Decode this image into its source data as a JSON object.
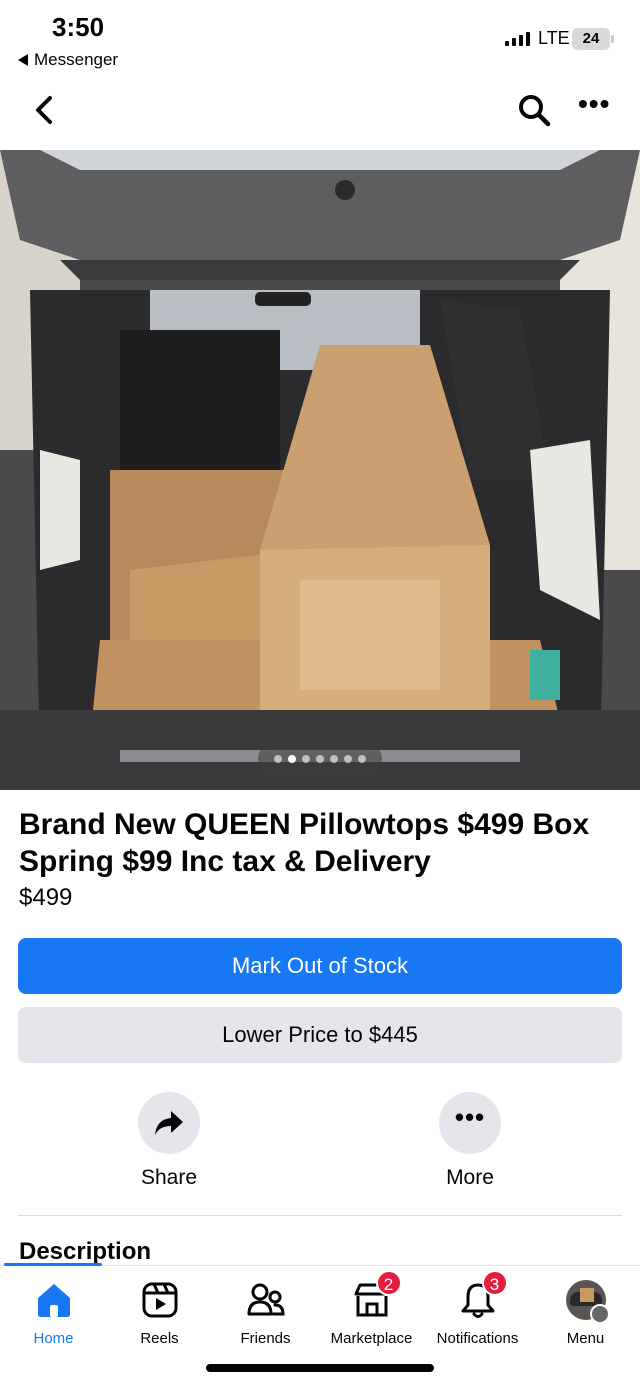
{
  "status_bar": {
    "time": "3:50",
    "back_app": "Messenger",
    "network": "LTE",
    "battery": "24"
  },
  "nav": {
    "back_icon": "chevron-left-icon",
    "search_icon": "search-icon",
    "more_icon": "more-horizontal-icon"
  },
  "photo": {
    "page_count": 7,
    "active_index": 1
  },
  "listing": {
    "title": "Brand New QUEEN Pillowtops $499 Box Spring $99 Inc tax & Delivery",
    "price": "$499"
  },
  "buttons": {
    "primary": "Mark Out of Stock",
    "secondary": "Lower Price to $445"
  },
  "actions": [
    {
      "label": "Share",
      "icon": "share-arrow-icon"
    },
    {
      "label": "More",
      "icon": "more-horizontal-icon"
    }
  ],
  "description": {
    "heading": "Description"
  },
  "tabbar": {
    "active": "Home",
    "colors": {
      "accent": "#1877f2",
      "badge": "#e41e3f"
    },
    "tabs": [
      {
        "label": "Home",
        "icon": "home-icon"
      },
      {
        "label": "Reels",
        "icon": "reels-icon"
      },
      {
        "label": "Friends",
        "icon": "friends-icon"
      },
      {
        "label": "Marketplace",
        "icon": "marketplace-icon",
        "badge": "2"
      },
      {
        "label": "Notifications",
        "icon": "bell-icon",
        "badge": "3"
      },
      {
        "label": "Menu",
        "icon": "avatar-icon"
      }
    ]
  }
}
